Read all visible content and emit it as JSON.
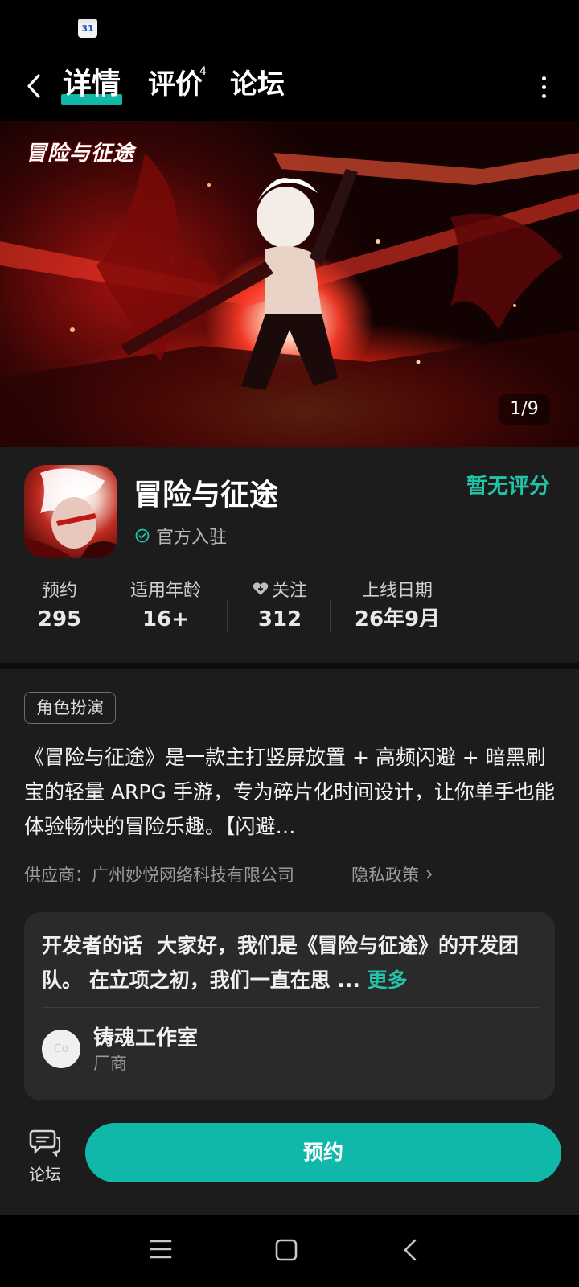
{
  "status_bar": {
    "calendar_day": "31"
  },
  "nav": {
    "tabs": [
      {
        "label": "详情"
      },
      {
        "label": "评价",
        "badge": "4"
      },
      {
        "label": "论坛"
      }
    ]
  },
  "banner": {
    "logo_text": "冒险与征途",
    "counter": "1/9"
  },
  "app": {
    "name": "冒险与征途",
    "official_label": "官方入驻",
    "rating_text": "暂无评分",
    "stats": [
      {
        "label": "预约",
        "value": "295"
      },
      {
        "label": "适用年龄",
        "value": "16+"
      },
      {
        "label": "关注",
        "value": "312"
      },
      {
        "label": "上线日期",
        "value": "26年9月"
      }
    ]
  },
  "description": {
    "genre_tag": "角色扮演",
    "text": "《冒险与征途》是一款主打竖屏放置 + 高频闪避 + 暗黑刷宝的轻量 ARPG 手游，专为碎片化时间设计，让你单手也能体验畅快的冒险乐趣。【闪避…",
    "supplier": "供应商：广州妙悦网络科技有限公司",
    "privacy_link": "隐私政策"
  },
  "developer": {
    "title": "开发者的话",
    "message": "大家好，我们是《冒险与征途》的开发团队。 在立项之初，我们一直在思 ...",
    "more_label": "更多",
    "avatar_text": "Co",
    "studio_name": "铸魂工作室",
    "studio_role": "厂商"
  },
  "actions": {
    "forum_label": "论坛",
    "reserve_label": "预约"
  },
  "colors": {
    "accent": "#0fb8a8",
    "rating": "#22c3a8",
    "card_bg": "#1c1c1c"
  }
}
